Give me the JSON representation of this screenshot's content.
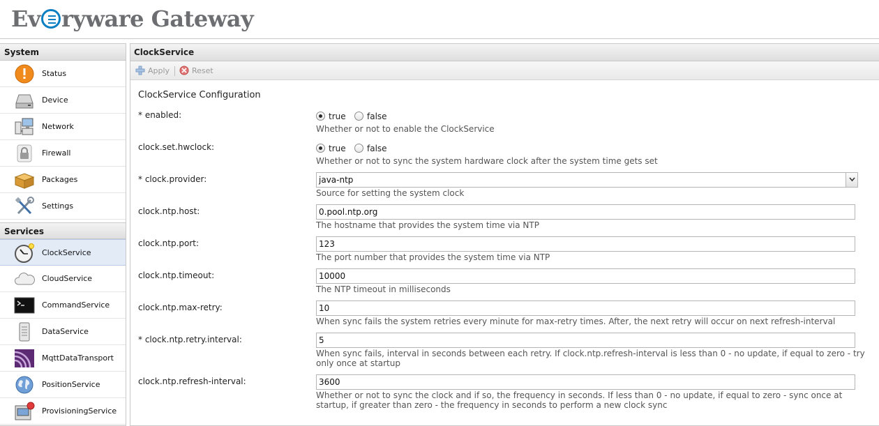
{
  "app": {
    "title": "Everyware Gateway"
  },
  "sidebar": {
    "system_title": "System",
    "services_title": "Services",
    "system_items": [
      {
        "label": "Status",
        "icon": "status-icon"
      },
      {
        "label": "Device",
        "icon": "device-icon"
      },
      {
        "label": "Network",
        "icon": "network-icon"
      },
      {
        "label": "Firewall",
        "icon": "firewall-icon"
      },
      {
        "label": "Packages",
        "icon": "packages-icon"
      },
      {
        "label": "Settings",
        "icon": "settings-icon"
      }
    ],
    "service_items": [
      {
        "label": "ClockService",
        "icon": "clock-icon",
        "selected": true
      },
      {
        "label": "CloudService",
        "icon": "cloud-icon"
      },
      {
        "label": "CommandService",
        "icon": "terminal-icon"
      },
      {
        "label": "DataService",
        "icon": "data-icon"
      },
      {
        "label": "MqttDataTransport",
        "icon": "mqtt-icon"
      },
      {
        "label": "PositionService",
        "icon": "globe-icon"
      },
      {
        "label": "ProvisioningService",
        "icon": "provisioning-icon"
      }
    ]
  },
  "main": {
    "title": "ClockService",
    "toolbar": {
      "apply_label": "Apply",
      "reset_label": "Reset"
    },
    "section_title": "ClockService Configuration",
    "fields": {
      "enabled": {
        "label": "* enabled:",
        "options": [
          "true",
          "false"
        ],
        "selected": "true",
        "description": "Whether or not to enable the ClockService"
      },
      "hwclock": {
        "label": "clock.set.hwclock:",
        "options": [
          "true",
          "false"
        ],
        "selected": "true",
        "description": "Whether or not to sync the system hardware clock after the system time gets set"
      },
      "provider": {
        "label": "* clock.provider:",
        "value": "java-ntp",
        "description": "Source for setting the system clock"
      },
      "ntp_host": {
        "label": "clock.ntp.host:",
        "value": "0.pool.ntp.org",
        "description": "The hostname that provides the system time via NTP"
      },
      "ntp_port": {
        "label": "clock.ntp.port:",
        "value": "123",
        "description": "The port number that provides the system time via NTP"
      },
      "ntp_timeout": {
        "label": "clock.ntp.timeout:",
        "value": "10000",
        "description": "The NTP timeout in milliseconds"
      },
      "ntp_max_retry": {
        "label": "clock.ntp.max-retry:",
        "value": "10",
        "description": "When sync fails the system retries every minute for max-retry times. After, the next retry will occur on next refresh-interval"
      },
      "ntp_retry_interval": {
        "label": "* clock.ntp.retry.interval:",
        "value": "5",
        "description": "When sync fails, interval in seconds between each retry. If clock.ntp.refresh-interval is less than 0 - no update, if equal to zero - try only once at startup"
      },
      "ntp_refresh_interval": {
        "label": "clock.ntp.refresh-interval:",
        "value": "3600",
        "description": "Whether or not to sync the clock and if so, the frequency in seconds. If less than 0 - no update, if equal to zero - sync once at startup, if greater than zero - the frequency in seconds to perform a new clock sync"
      }
    }
  }
}
